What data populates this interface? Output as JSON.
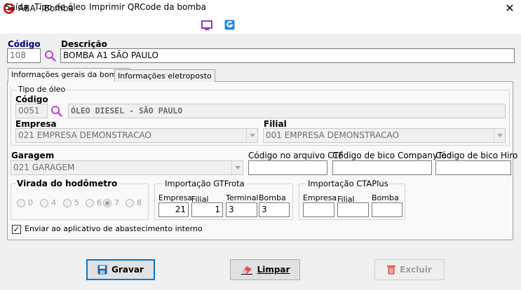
{
  "window": {
    "title": "ABA - Bomba",
    "close_glyph": "✕"
  },
  "menu": {
    "items": [
      "Saída",
      "Tipo de óleo",
      "Imprimir QRCode da bomba"
    ]
  },
  "header": {
    "codigo_label": "Código",
    "codigo_value": "108",
    "descricao_label": "Descrição",
    "descricao_value": "BOMBA A1 SÃO PAULO"
  },
  "tabs": [
    {
      "label": "Informações gerais da bomba",
      "active": true
    },
    {
      "label": "Informações eletroposto",
      "active": false
    }
  ],
  "tipo_oleo": {
    "group_title": "Tipo de óleo",
    "codigo_label": "Código",
    "codigo_value": "0051",
    "descricao_value": "ÓLEO DIESEL - SÃO PAULO",
    "empresa_label": "Empresa",
    "empresa_value": "021 EMPRESA DEMONSTRACAO",
    "filial_label": "Filial",
    "filial_value": "001 EMPRESA DEMONSTRACAO"
  },
  "garagem": {
    "label": "Garagem",
    "value": "021 GARAGEM",
    "ctf_label": "Código no arquivo CTF",
    "ctf_value": "",
    "companytec_label": "Código de bico CompanyTec",
    "companytec_value": "",
    "hiro_label": "Código de bico Hiro",
    "hiro_value": ""
  },
  "hodometro": {
    "title": "Virada do hodômetro",
    "options": [
      "0",
      "4",
      "5",
      "6",
      "7",
      "8"
    ],
    "selected": "7"
  },
  "gtfrota": {
    "title": "Importação GTFrota",
    "empresa_label": "Empresa",
    "empresa_value": "21",
    "filial_label": "Filial",
    "filial_value": "1",
    "terminal_label": "Terminal",
    "terminal_value": "3",
    "bomba_label": "Bomba",
    "bomba_value": "3"
  },
  "ctaplus": {
    "title": "Importação CTAPlus",
    "empresa_label": "Empresa",
    "empresa_value": "",
    "filial_label": "Filial",
    "filial_value": "",
    "bomba_label": "Bomba",
    "bomba_value": ""
  },
  "checkbox": {
    "label": "Enviar ao aplicativo de abastecimento interno",
    "checked": true,
    "glyph": "✓"
  },
  "buttons": {
    "gravar": "Gravar",
    "limpar": "Limpar",
    "excluir": "Excluir"
  },
  "colors": {
    "accent": "#0078d7",
    "navy": "#000080",
    "search_icon": "#b847d6",
    "logo": "#d2232a",
    "excluir_icon": "#e04f4f",
    "gravar_icon": "#1f5fa8"
  }
}
